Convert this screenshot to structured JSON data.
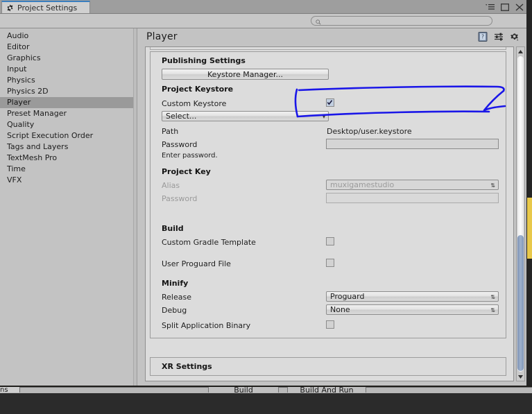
{
  "window": {
    "tab_title": "Project Settings",
    "tab_icon": "gear-icon",
    "controls": {
      "menu": "▾≡",
      "maximize": "maximize-icon",
      "close": "close-icon"
    }
  },
  "search": {
    "placeholder": "",
    "value": "",
    "icon": "search-icon"
  },
  "sidebar": {
    "items": [
      {
        "label": "Audio",
        "selected": false
      },
      {
        "label": "Editor",
        "selected": false
      },
      {
        "label": "Graphics",
        "selected": false
      },
      {
        "label": "Input",
        "selected": false
      },
      {
        "label": "Physics",
        "selected": false
      },
      {
        "label": "Physics 2D",
        "selected": false
      },
      {
        "label": "Player",
        "selected": true
      },
      {
        "label": "Preset Manager",
        "selected": false
      },
      {
        "label": "Quality",
        "selected": false
      },
      {
        "label": "Script Execution Order",
        "selected": false
      },
      {
        "label": "Tags and Layers",
        "selected": false
      },
      {
        "label": "TextMesh Pro",
        "selected": false
      },
      {
        "label": "Time",
        "selected": false
      },
      {
        "label": "VFX",
        "selected": false
      }
    ]
  },
  "panel": {
    "title": "Player",
    "icons": [
      {
        "name": "help-icon"
      },
      {
        "name": "preset-icon"
      },
      {
        "name": "settings-gear-icon"
      }
    ]
  },
  "publishing": {
    "section_title": "Publishing Settings",
    "keystore_manager_button": "Keystore Manager...",
    "project_keystore": {
      "title": "Project Keystore",
      "custom_keystore_label": "Custom Keystore",
      "custom_keystore_checked": true,
      "select_dropdown": "Select...",
      "path_label": "Path",
      "path_value": "Desktop/user.keystore",
      "password_label": "Password",
      "password_value": "",
      "password_hint": "Enter password."
    },
    "project_key": {
      "title": "Project Key",
      "alias_label": "Alias",
      "alias_value": "muxigamestudio",
      "password_label": "Password",
      "password_value": ""
    },
    "build": {
      "title": "Build",
      "custom_gradle_label": "Custom Gradle Template",
      "custom_gradle_checked": false,
      "user_proguard_label": "User Proguard File",
      "user_proguard_checked": false
    },
    "minify": {
      "title": "Minify",
      "release_label": "Release",
      "release_value": "Proguard",
      "debug_label": "Debug",
      "debug_value": "None",
      "split_binary_label": "Split Application Binary",
      "split_binary_checked": false
    }
  },
  "xr": {
    "section_title": "XR Settings"
  },
  "bottom_bar": {
    "build_label": "Build",
    "build_and_run_label": "Build And Run",
    "left_label": "ns"
  },
  "annotation": {
    "color": "#1a16e8",
    "shape": "hand-drawn-highlight-around-keystore-manager"
  }
}
